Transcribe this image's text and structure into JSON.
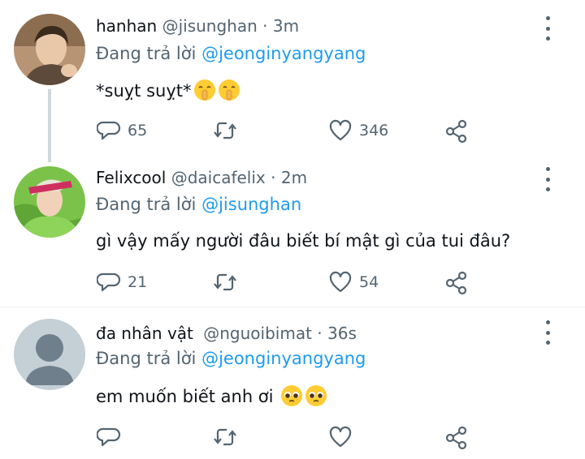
{
  "tweets": [
    {
      "name": "hanhan",
      "handle": "@jisunghan",
      "separator": "·",
      "time": "3m",
      "replying_prefix": "Đang trả lời",
      "replying_to": "@jeonginyangyang",
      "text": "*suỵt suỵt*",
      "emojis": [
        "shushing-face",
        "shushing-face"
      ],
      "replies": "65",
      "retweets": "",
      "likes": "346",
      "avatar_colors": [
        "#c6a27f",
        "#5a4634"
      ]
    },
    {
      "name": "Felixcool",
      "handle": "@daicafelix",
      "separator": "·",
      "time": "2m",
      "replying_prefix": "Đang trả lời",
      "replying_to": "@jisunghan",
      "text": "gì vậy mấy người đâu biết bí mật gì của tui đâu?",
      "emojis": [],
      "replies": "21",
      "retweets": "",
      "likes": "54",
      "avatar_colors": [
        "#7fc843",
        "#d23d6a"
      ]
    },
    {
      "name": "đa nhân vật",
      "handle": "@nguoibimat",
      "separator": "·",
      "time": "36s",
      "replying_prefix": "Đang trả lời",
      "replying_to": "@jeonginyangyang",
      "text": "em muốn biết anh ơi",
      "emojis": [
        "pleading-face",
        "pleading-face"
      ],
      "replies": "",
      "retweets": "",
      "likes": "",
      "avatar_colors": [
        "#c4cfd6",
        "#6f7f8b"
      ]
    }
  ],
  "colors": {
    "text": "#0f1419",
    "secondary": "#536471",
    "accent": "#1d9bf0",
    "thread_line": "#cfd9de"
  },
  "icons": {
    "reply": "reply-icon",
    "retweet": "retweet-icon",
    "like": "heart-icon",
    "share": "share-icon",
    "more": "more-vertical-icon"
  }
}
